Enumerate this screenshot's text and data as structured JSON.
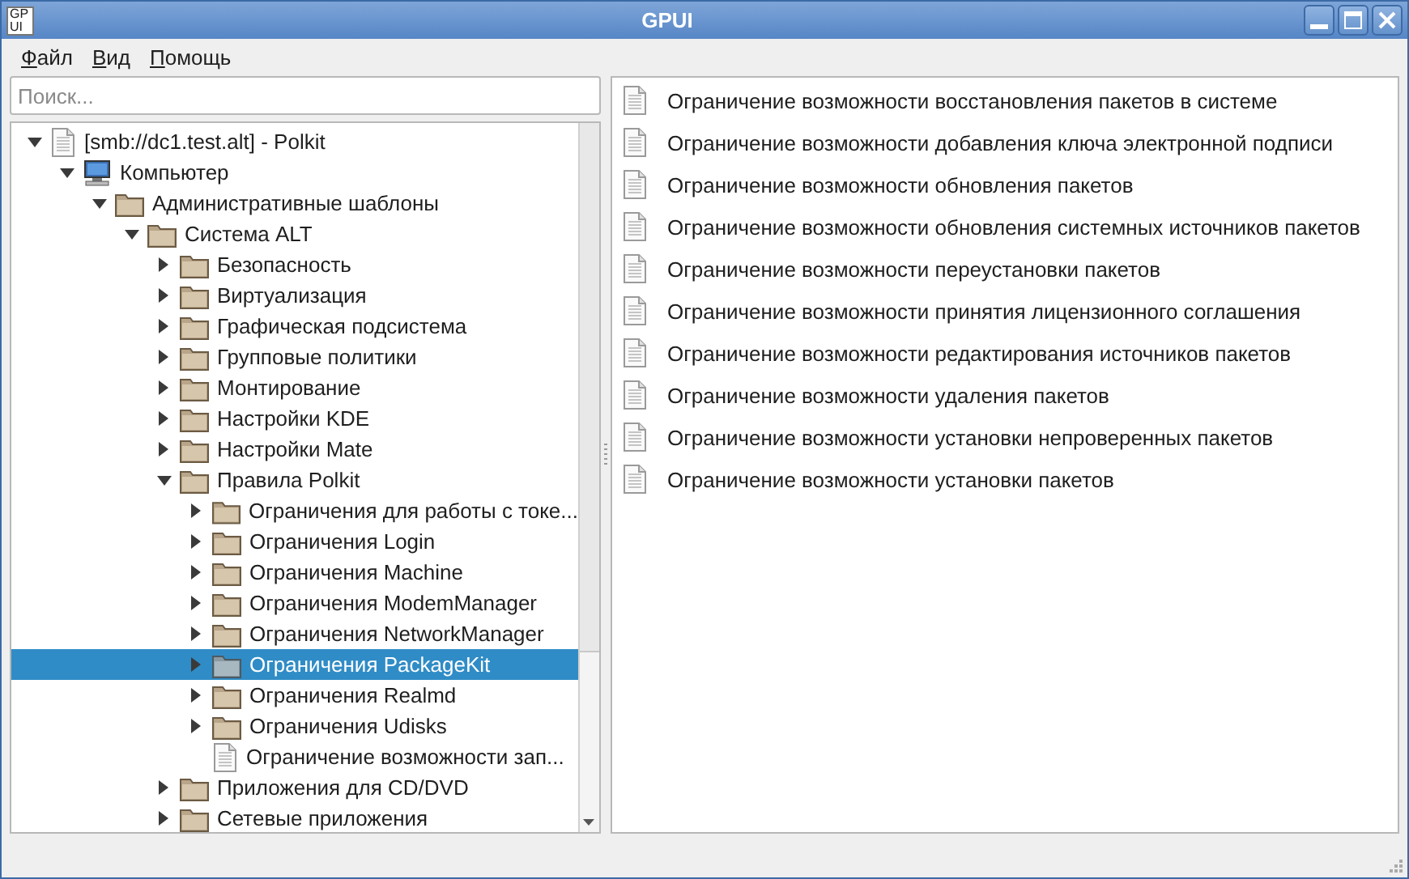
{
  "window": {
    "title": "GPUI",
    "logo": [
      "GP",
      "UI"
    ]
  },
  "menu": [
    {
      "label": "Файл"
    },
    {
      "label": "Вид"
    },
    {
      "label": "Помощь"
    }
  ],
  "search": {
    "placeholder": "Поиск..."
  },
  "tree": [
    {
      "label": "[smb://dc1.test.alt] - Polkit",
      "kind": "document",
      "expanded": true,
      "selected": false,
      "children": [
        {
          "label": "Компьютер",
          "kind": "computer",
          "expanded": true,
          "selected": false,
          "children": [
            {
              "label": "Административные шаблоны",
              "kind": "folder",
              "expanded": true,
              "selected": false,
              "children": [
                {
                  "label": "Система ALT",
                  "kind": "folder",
                  "expanded": true,
                  "selected": false,
                  "children": [
                    {
                      "label": "Безопасность",
                      "kind": "folder",
                      "expanded": false,
                      "selected": false
                    },
                    {
                      "label": "Виртуализация",
                      "kind": "folder",
                      "expanded": false,
                      "selected": false
                    },
                    {
                      "label": "Графическая подсистема",
                      "kind": "folder",
                      "expanded": false,
                      "selected": false
                    },
                    {
                      "label": "Групповые политики",
                      "kind": "folder",
                      "expanded": false,
                      "selected": false
                    },
                    {
                      "label": "Монтирование",
                      "kind": "folder",
                      "expanded": false,
                      "selected": false
                    },
                    {
                      "label": "Настройки KDE",
                      "kind": "folder",
                      "expanded": false,
                      "selected": false
                    },
                    {
                      "label": "Настройки Mate",
                      "kind": "folder",
                      "expanded": false,
                      "selected": false
                    },
                    {
                      "label": "Правила Polkit",
                      "kind": "folder",
                      "expanded": true,
                      "selected": false,
                      "children": [
                        {
                          "label": "Ограничения для работы с токе...",
                          "kind": "folder",
                          "expanded": false,
                          "selected": false
                        },
                        {
                          "label": "Ограничения Login",
                          "kind": "folder",
                          "expanded": false,
                          "selected": false
                        },
                        {
                          "label": "Ограничения Machine",
                          "kind": "folder",
                          "expanded": false,
                          "selected": false
                        },
                        {
                          "label": "Ограничения ModemManager",
                          "kind": "folder",
                          "expanded": false,
                          "selected": false
                        },
                        {
                          "label": "Ограничения NetworkManager",
                          "kind": "folder",
                          "expanded": false,
                          "selected": false
                        },
                        {
                          "label": "Ограничения PackageKit",
                          "kind": "folder",
                          "expanded": false,
                          "selected": true
                        },
                        {
                          "label": "Ограничения Realmd",
                          "kind": "folder",
                          "expanded": false,
                          "selected": false
                        },
                        {
                          "label": "Ограничения Udisks",
                          "kind": "folder",
                          "expanded": false,
                          "selected": false
                        },
                        {
                          "label": "Ограничение возможности зап...",
                          "kind": "document",
                          "selected": false
                        }
                      ]
                    },
                    {
                      "label": "Приложения для CD/DVD",
                      "kind": "folder",
                      "expanded": false,
                      "selected": false
                    },
                    {
                      "label": "Сетевые приложения",
                      "kind": "folder",
                      "expanded": false,
                      "selected": false
                    }
                  ]
                }
              ]
            }
          ]
        }
      ]
    }
  ],
  "list": [
    {
      "label": "Ограничение возможности восстановления пакетов в системе"
    },
    {
      "label": "Ограничение возможности добавления ключа электронной подписи"
    },
    {
      "label": "Ограничение возможности обновления пакетов"
    },
    {
      "label": "Ограничение возможности обновления системных источников пакетов"
    },
    {
      "label": "Ограничение возможности переустановки пакетов"
    },
    {
      "label": "Ограничение возможности принятия лицензионного соглашения"
    },
    {
      "label": "Ограничение возможности редактирования источников пакетов"
    },
    {
      "label": "Ограничение возможности удаления пакетов"
    },
    {
      "label": "Ограничение возможности установки непроверенных пакетов"
    },
    {
      "label": "Ограничение возможности установки пакетов"
    }
  ]
}
